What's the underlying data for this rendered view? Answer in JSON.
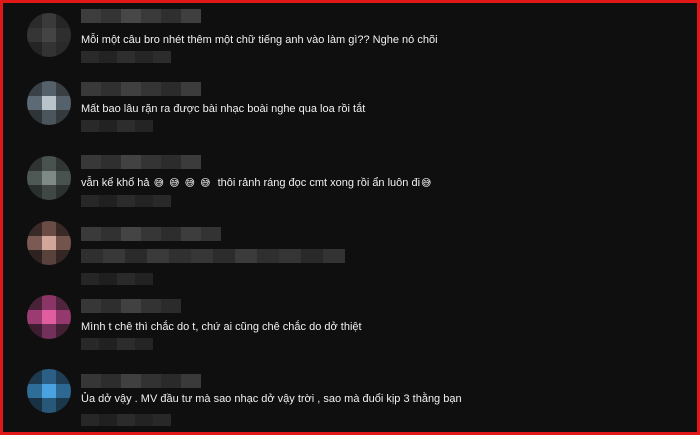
{
  "comments": [
    {
      "text": "Mỗi một câu bro nhét thêm một chữ tiếng anh vào làm gì?? Nghe nó chõi"
    },
    {
      "text": "Mất bao lâu rặn ra được bài nhạc boài nghe qua loa rồi tắt"
    },
    {
      "text_a": "vẫn kể khổ hả",
      "emoji": "😅",
      "text_b": "thôi rảnh ráng đọc cmt xong rồi ẩn luôn đi"
    },
    {
      "text": ""
    },
    {
      "text": "Mình t chê thì chắc do t, chứ ai cũng chê chắc do dở thiệt"
    },
    {
      "text": "Ủa dở vậy . MV đầu tư mà sao nhạc dở vậy trời , sao mà đuổi kịp 3 thằng bạn"
    }
  ],
  "colors": {
    "frame_border": "#e01818",
    "background": "#0f0f0f",
    "text": "#f1f1f1"
  }
}
